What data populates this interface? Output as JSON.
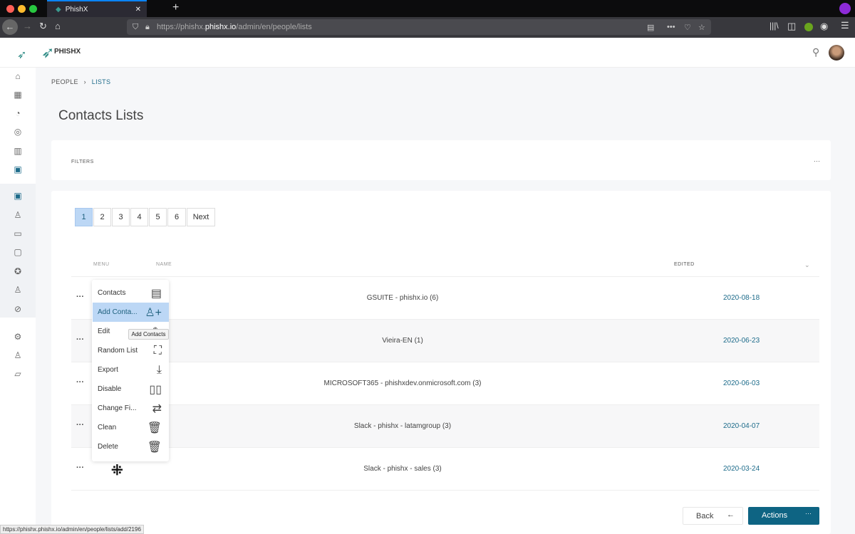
{
  "browser": {
    "tab_title": "PhishX",
    "url_prefix": "https://phishx.",
    "url_domain": "phishx.io",
    "url_path": "/admin/en/people/lists",
    "status_url": "https://phishx.phishx.io/admin/en/people/lists/add/2196"
  },
  "header": {
    "logo_text": "PHISHX"
  },
  "breadcrumb": {
    "parent": "PEOPLE",
    "current": "LISTS"
  },
  "page": {
    "title": "Contacts Lists",
    "filters_label": "FILTERS",
    "filters_more": "···"
  },
  "pagination": {
    "pages": [
      "1",
      "2",
      "3",
      "4",
      "5",
      "6"
    ],
    "active": "1",
    "next": "Next"
  },
  "table": {
    "columns": {
      "menu": "MENU",
      "name": "NAME",
      "edited": "EDITED"
    },
    "rows": [
      {
        "menu": "···",
        "name": "GSUITE - phishx.io (6)",
        "edited": "2020-08-18"
      },
      {
        "menu": "···",
        "name": "Vieira-EN (1)",
        "edited": "2020-06-23"
      },
      {
        "menu": "···",
        "name": "MICROSOFT365 - phishxdev.onmicrosoft.com (3)",
        "edited": "2020-06-03"
      },
      {
        "menu": "···",
        "name": "Slack - phishx - latamgroup (3)",
        "edited": "2020-04-07"
      },
      {
        "menu": "···",
        "name": "Slack - phishx - sales (3)",
        "edited": "2020-03-24"
      }
    ]
  },
  "menu": {
    "items": [
      "Contacts",
      "Add Conta...",
      "Edit",
      "Random List",
      "Export",
      "Disable",
      "Change Fi...",
      "Clean",
      "Delete"
    ],
    "active": "Add Conta...",
    "tooltip": "Add Contacts"
  },
  "footer": {
    "back": "Back",
    "actions": "Actions",
    "actions_more": "···"
  },
  "colors": {
    "accent": "#0e6483",
    "link": "#1d6b8a",
    "active_menu": "#bcd7f5"
  }
}
